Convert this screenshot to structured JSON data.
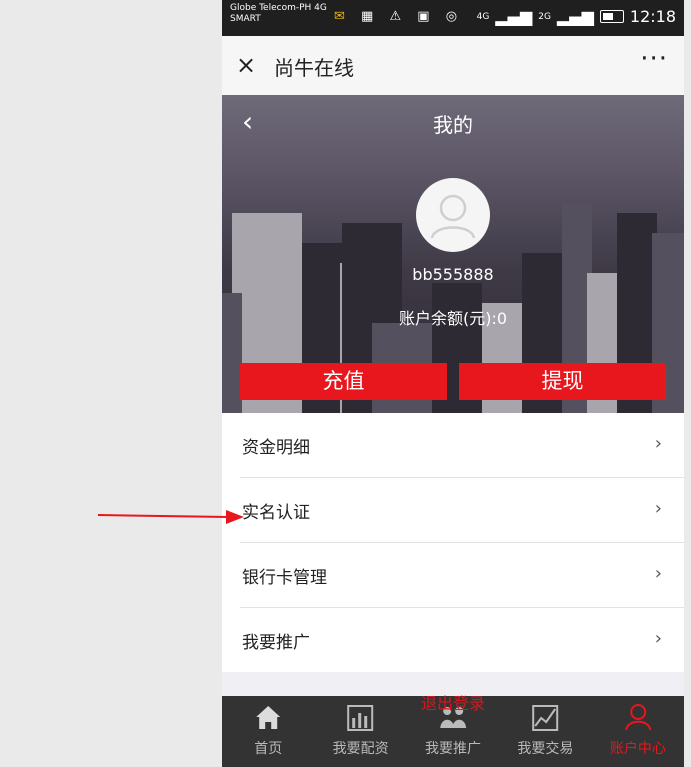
{
  "status_bar": {
    "carrier": "Globe Telecom-PH 4G",
    "carrier2": "SMART",
    "net1": "4G",
    "net2": "2G",
    "time": "12:18"
  },
  "titlebar": {
    "title": "尚牛在线",
    "close_icon": "×",
    "more_icon": "···"
  },
  "profile": {
    "page_title": "我的",
    "back_icon": "‹",
    "username": "bb555888",
    "balance": "账户余额(元):0",
    "recharge_label": "充值",
    "withdraw_label": "提现"
  },
  "menu": {
    "items": [
      {
        "label": "资金明细"
      },
      {
        "label": "实名认证"
      },
      {
        "label": "银行卡管理"
      },
      {
        "label": "我要推广"
      }
    ],
    "chevron": "›"
  },
  "logout_label": "退出登录",
  "tabbar": {
    "tabs": [
      {
        "label": "首页",
        "icon": "home-icon"
      },
      {
        "label": "我要配资",
        "icon": "chart-icon"
      },
      {
        "label": "我要推广",
        "icon": "people-icon"
      },
      {
        "label": "我要交易",
        "icon": "trade-chart-icon"
      },
      {
        "label": "账户中心",
        "icon": "user-icon"
      }
    ]
  },
  "colors": {
    "accent": "#e8161d",
    "tabbar": "#333333"
  }
}
